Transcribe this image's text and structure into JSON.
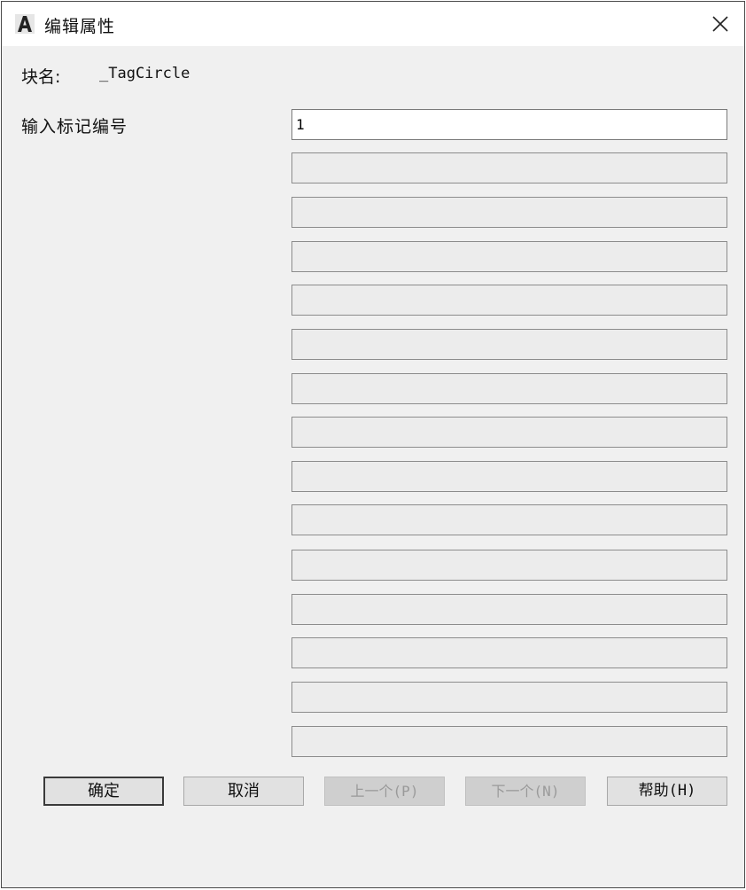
{
  "window": {
    "title": "编辑属性",
    "app_icon": "autocad-a-icon",
    "close_icon": "close-icon"
  },
  "block": {
    "label": "块名:",
    "name": "_TagCircle"
  },
  "attributes": {
    "prompt": "输入标记编号",
    "value": "1",
    "empty_field_count_label": ""
  },
  "buttons": {
    "ok": "确定",
    "cancel": "取消",
    "previous": "上一个(P)",
    "next": "下一个(N)",
    "help": "帮助(H)"
  }
}
